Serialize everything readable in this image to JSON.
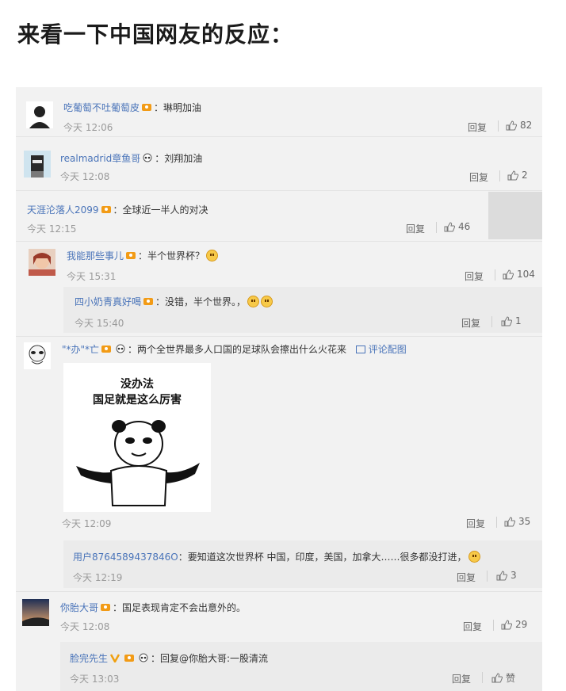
{
  "headline": "来看一下中国网友的反应：",
  "reply_label": "回复",
  "comments": [
    {
      "user": "吃葡萄不吐葡萄皮",
      "text": "：琳明加油",
      "time": "今天 12:06",
      "likes": "82"
    },
    {
      "user": "realmadrid章鱼哥",
      "text": "：刘翔加油",
      "time": "今天 12:08",
      "likes": "2"
    },
    {
      "user": "天涯沦落人2099",
      "text": "：全球近一半人的对决",
      "time": "今天 12:15",
      "likes": "46"
    },
    {
      "user": "我能那些事儿",
      "text": "：半个世界杯？",
      "time": "今天 15:31",
      "likes": "104"
    },
    {
      "user": "四小奶青真好喝",
      "text": "：没错，半个世界。，",
      "time": "今天 15:40",
      "likes": "1"
    },
    {
      "user": "\"*办\"*亡",
      "text": "：两个全世界最多人口国的足球队会擦出什么火花来",
      "link": "评论配图",
      "time": "今天 12:09",
      "likes": "35"
    },
    {
      "user": "用户8764589437846O",
      "text": "：要知道这次世界杯 中国，印度，美国，加拿大……很多都没打进，",
      "time": "今天 12:19",
      "likes": "3"
    },
    {
      "user": "你胎大哥",
      "text": "：国足表现肯定不会出意外的。",
      "time": "今天 12:08",
      "likes": "29"
    },
    {
      "user": "脸完先生",
      "text": "：回复@你胎大哥:一股清流",
      "time": "今天 13:03",
      "likes": "赞"
    }
  ],
  "meme": {
    "line1": "没办法",
    "line2": "国足就是这么厉害"
  },
  "icons": [
    "thumbs-up-icon",
    "vip-badge-icon",
    "panda-icon",
    "smiley-emoji-icon",
    "image-icon"
  ],
  "colors": {
    "username": "#4a74b9",
    "timestamp": "#9a9a9a",
    "panel": "#f2f2f2"
  }
}
